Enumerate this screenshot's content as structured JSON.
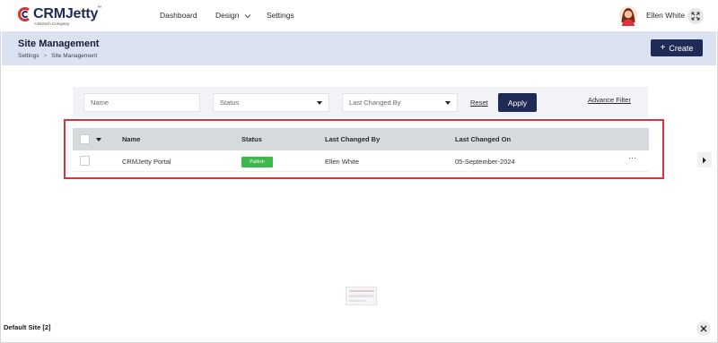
{
  "brand": {
    "name_prefix": "C",
    "name": "CRMJetty",
    "trademark": "™",
    "tagline": "A Biztech Company"
  },
  "nav": {
    "items": [
      {
        "label": "Dashboard"
      },
      {
        "label": "Design"
      },
      {
        "label": "Settings"
      }
    ]
  },
  "user": {
    "name": "Ellen White"
  },
  "header": {
    "title": "Site Management",
    "breadcrumb": [
      "Settings",
      ">",
      "Site Management"
    ],
    "create_label": "Create",
    "create_icon": "+"
  },
  "filters": {
    "name_placeholder": "Name",
    "status_label": "Status",
    "last_changed_by_label": "Last Changed By",
    "reset_label": "Reset",
    "apply_label": "Apply",
    "advance_filter_label": "Advance Filter"
  },
  "table": {
    "columns": [
      "Name",
      "Status",
      "Last Changed By",
      "Last Changed On"
    ],
    "rows": [
      {
        "name": "CRMJetty Portal",
        "status": "Publish",
        "last_changed_by": "Ellen White",
        "last_changed_on": "05-September-2024",
        "menu": "···"
      }
    ]
  },
  "footer": {
    "label": "Default Site [2]"
  },
  "colors": {
    "accent": "#1f2b57",
    "header_band": "#dbe2f2",
    "publish_badge": "#3cb94b",
    "highlight": "#d9343b",
    "brand_red": "#d9343b"
  },
  "icons": {
    "logo": "crmjetty-logo-icon",
    "expand": "expand-icon",
    "close": "close-icon",
    "chevron_right": "chevron-right-icon",
    "chevron_down": "chevron-down-icon"
  }
}
